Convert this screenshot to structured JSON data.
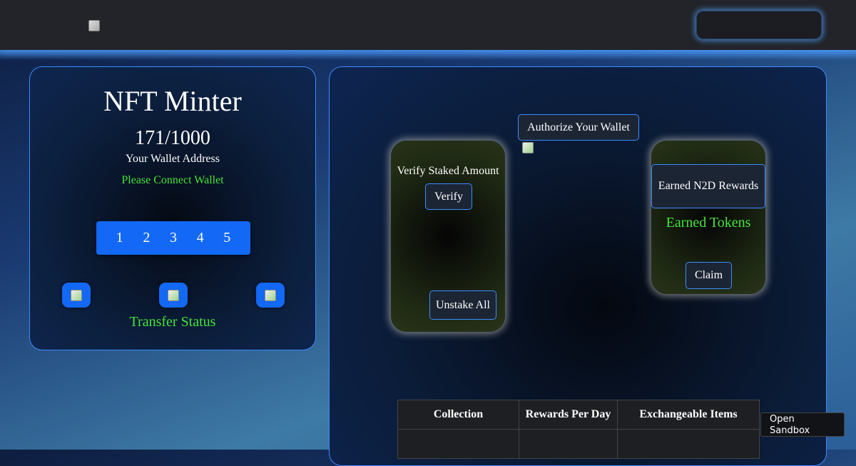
{
  "minter": {
    "title": "NFT Minter",
    "count": "171/1000",
    "wallet_label": "Your Wallet Address",
    "wallet_status": "Please Connect Wallet",
    "quantities": [
      "1",
      "2",
      "3",
      "4",
      "5"
    ],
    "transfer_status": "Transfer Status"
  },
  "staking": {
    "authorize_label": "Authorize Your Wallet",
    "verify_card": {
      "heading": "Verify Staked Amount",
      "verify_label": "Verify",
      "unstake_label": "Unstake All"
    },
    "rewards_card": {
      "heading": "Earned N2D Rewards",
      "earned_tokens": "Earned Tokens",
      "claim_label": "Claim"
    },
    "table": {
      "headers": [
        "Collection",
        "Rewards Per Day",
        "Exchangeable Items"
      ]
    }
  },
  "sandbox_label": "Open Sandbox",
  "colors": {
    "accent_blue": "#1368f5",
    "status_green": "#45e43a",
    "topbar": "#222429"
  }
}
